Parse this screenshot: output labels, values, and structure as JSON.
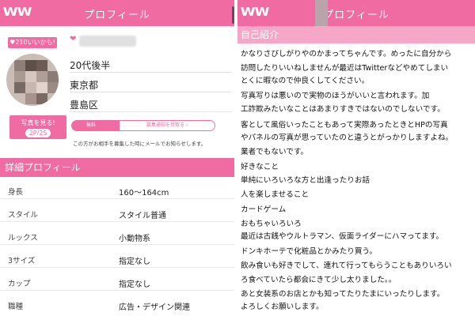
{
  "app": {
    "logo_text": "WW",
    "title": "プロフィール"
  },
  "profile": {
    "like_badge": "♥210いいかも!",
    "age": "20代後半",
    "prefecture": "東京都",
    "area": "豊島区",
    "photo_button": {
      "label": "写真を見る!",
      "count": "2P/2S"
    },
    "mail_toggle": {
      "on_label": "無料",
      "off_label": "募集通知を受取る ›"
    },
    "note": "この方がお相手を募集した時にメールでお知らせします。"
  },
  "detail": {
    "heading": "詳細プロフィール",
    "rows": [
      {
        "key": "身長",
        "value": "160〜164cm"
      },
      {
        "key": "スタイル",
        "value": "スタイル普通"
      },
      {
        "key": "ルックス",
        "value": "小動物系"
      },
      {
        "key": "3サイズ",
        "value": "指定なし"
      },
      {
        "key": "カップ",
        "value": "指定なし"
      },
      {
        "key": "職種",
        "value": "広告・デザイン関連"
      }
    ]
  },
  "intro": {
    "heading": "自己紹介",
    "lines": [
      "かなりさびしがりやのかまってちゃんです。めったに自分から",
      "訪問したりいいねしませんが最近はTwitterなどやめてしまい",
      "とくに暇なので仲良くしてください。",
      "写真写りは悪いので実物のほうがいいと言われます。加",
      "工詐欺みたいなことはあまりすきではないのでしないです。",
      "客として風俗いったこともあって実際あったときとHPの写真",
      "やパネルの写真が思っていたのと違うとがっかりしますよね。",
      "業者でもないです。",
      "好きなこと",
      "単純にいろいろな方と出逢ったりお話",
      "人を楽しませること",
      "カードゲーム",
      "おもちゃいろいろ",
      "最近は古銭やウルトラマン、仮面ライダーにハマってます。",
      "ドンキホーテで化粧品とかみたり買う。",
      "飲み食いも好きでして、連れて行ってもらうこともありいろい",
      "ろ食べていたら都会にきて少し太りました。。",
      "あと女装系のお店とかも知ってたりたまにいったりします。",
      "よろしくお願いします。"
    ]
  },
  "colors": {
    "brand_pink": "#ef6ba1",
    "light_pink": "#f6a7c7"
  },
  "icons": {
    "logo": "ww-logo-icon",
    "heart": "heart-icon",
    "scroll": "scrollbar-thumb"
  }
}
